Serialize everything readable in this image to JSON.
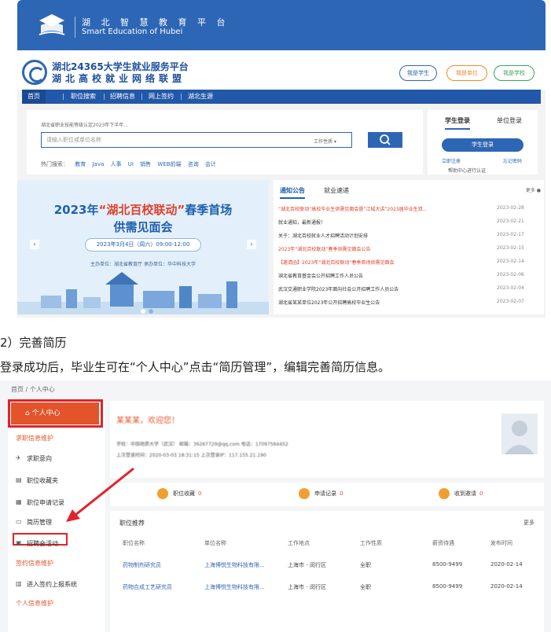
{
  "banner": {
    "title": "湖 北 智 慧 教 育 平 台",
    "subtitle": "Smart Education of Hubei"
  },
  "brand": {
    "title": "湖北24365大学生就业服务平台",
    "subtitle": "湖北高校就业网络联盟",
    "buttons": [
      "我是学生",
      "我是单位",
      "我是学校"
    ]
  },
  "nav": [
    "首页",
    "职位搜索",
    "招聘信息",
    "网上签约",
    "湖北生源"
  ],
  "search": {
    "notice": "湖北省职业技能等级认定2023年下半年...",
    "placeholder": "请输入职位或单位名称",
    "type_select": "工作性质 ▾",
    "hot_label": "热门搜索：",
    "hot_keywords": [
      "教育",
      "Java",
      "人事",
      "UI",
      "销售",
      "WEB前端",
      "咨询",
      "会计"
    ]
  },
  "login": {
    "tabs": [
      "学生登录",
      "单位登录"
    ],
    "button": "学生登录",
    "register": "立即注册",
    "forgot": "忘记密码",
    "note": "帮助中心进行认证"
  },
  "hero": {
    "title_a": "2023年",
    "title_quote": "“湖北百校联动”",
    "title_b": "春季首场",
    "title2": "供需见面会",
    "date": "2023年3月4日（周六）09:00-12:00",
    "org": "主办单位：湖北省教育厅 承办单位：华中科技大学"
  },
  "news": {
    "tabs": [
      "通知公告",
      "就业速递"
    ],
    "more": "更多",
    "items": [
      {
        "title": "“湖北百校联动”高校毕业生供需见面会暨“江城大讲”2023届毕业生双...",
        "date": "2023-02-28",
        "hot": true
      },
      {
        "title": "就业通知，最新通报！",
        "date": "2023-02-21",
        "hot": false
      },
      {
        "title": "关于：湖北百校就业人才招聘活动计划安排",
        "date": "2023-02-17",
        "hot": false
      },
      {
        "title": "2023年“湖北百校联动”春季供需见面会公告",
        "date": "2023-02-15",
        "hot": true
      },
      {
        "title": "【邀请函】2023年“湖北百校联动”春季首场供需见面会",
        "date": "2023-02-14",
        "hot": true
      },
      {
        "title": "湖北省教育基金会公开招聘工作人员公告",
        "date": "2023-02-06",
        "hot": false
      },
      {
        "title": "武汉交通职业学院2023年面向社会公开招聘工作人员公告",
        "date": "2023-02-04",
        "hot": false
      },
      {
        "title": "湖北省某某单位2023年公开招聘高校毕业生公告",
        "date": "2023-02-07",
        "hot": false
      }
    ]
  },
  "caption": {
    "heading": "2）完善简历",
    "body": "登录成功后，毕业生可在“个人中心”点击“简历管理”，编辑完善简历信息。"
  },
  "panel": {
    "breadcrumb": "首页 / 个人中心",
    "sidebar": {
      "active": "个人中心",
      "groups": [
        {
          "label": "求职信息维护",
          "items": [
            "求职意向",
            "职位收藏夹",
            "职位申请记录",
            "简历管理",
            "招聘会活动"
          ]
        },
        {
          "label": "签约信息维护",
          "items": [
            "进入签约上报系统"
          ]
        },
        {
          "label": "个人信息维护",
          "items": []
        }
      ]
    },
    "profile": {
      "greeting": "某某某，欢迎您！",
      "info1": "学校：中国地质大学（武汉）   邮箱：36267729@qq.com   电话：17097564452",
      "info2": "上次登录时间：2020-03-03 18:31:15   上次登录IP：117.155.21.190"
    },
    "stats": [
      {
        "label": "职位收藏",
        "count": "0"
      },
      {
        "label": "申请记录",
        "count": "0"
      },
      {
        "label": "收到邀请",
        "count": "0"
      }
    ],
    "recommend": {
      "title": "职位推荐",
      "more": "更多",
      "headers": [
        "职位名称",
        "单位名称",
        "工作地点",
        "工作性质",
        "薪资待遇",
        "发布时间"
      ],
      "rows": [
        [
          "药物制剂研究员",
          "上海博悦生物科技有限...",
          "上海市 - 闵行区",
          "全职",
          "8500-9499",
          "2020-02-14"
        ],
        [
          "药物合成工艺研究员",
          "上海博悦生物科技有限...",
          "上海市 - 闵行区",
          "全职",
          "8500-9499",
          "2020-02-14"
        ]
      ]
    }
  },
  "colors": {
    "primary": "#2e66b6",
    "accent": "#e3542b",
    "highlight": "#e3222a"
  }
}
